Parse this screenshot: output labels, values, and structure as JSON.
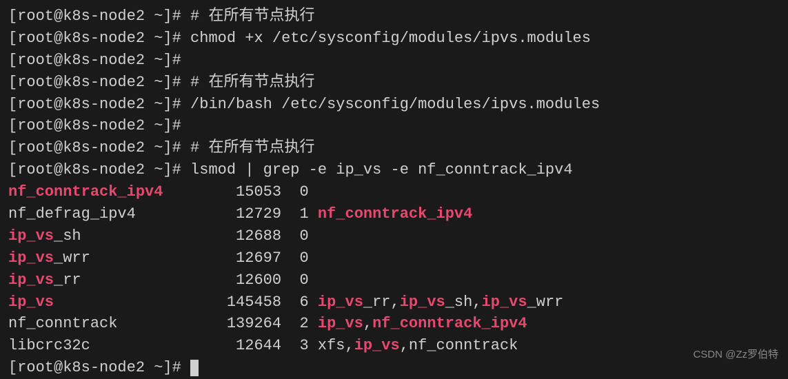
{
  "prompt": "[root@k8s-node2 ~]# ",
  "lines": [
    {
      "type": "cmd",
      "text": "# 在所有节点执行"
    },
    {
      "type": "cmd",
      "text": "chmod +x /etc/sysconfig/modules/ipvs.modules"
    },
    {
      "type": "cmd",
      "text": ""
    },
    {
      "type": "cmd",
      "text": "# 在所有节点执行"
    },
    {
      "type": "cmd",
      "text": "/bin/bash /etc/sysconfig/modules/ipvs.modules"
    },
    {
      "type": "cmd",
      "text": ""
    },
    {
      "type": "cmd",
      "text": "# 在所有节点执行"
    },
    {
      "type": "cmd",
      "text": "lsmod | grep -e ip_vs -e nf_conntrack_ipv4"
    }
  ],
  "lsmod": [
    {
      "col0_hl": "nf_conntrack_ipv4",
      "col0_rest": "",
      "size": "15053",
      "used": "0",
      "dep_plain1": "",
      "dep_hl1": "",
      "dep_plain2": "",
      "dep_hl2": "",
      "dep_plain3": "",
      "dep_hl3": "",
      "dep_plain4": ""
    },
    {
      "col0_hl": "",
      "col0_rest": "nf_defrag_ipv4",
      "size": "12729",
      "used": "1",
      "dep_plain1": " ",
      "dep_hl1": "nf_conntrack_ipv4",
      "dep_plain2": "",
      "dep_hl2": "",
      "dep_plain3": "",
      "dep_hl3": "",
      "dep_plain4": ""
    },
    {
      "col0_hl": "ip_vs",
      "col0_rest": "_sh",
      "size": "12688",
      "used": "0",
      "dep_plain1": "",
      "dep_hl1": "",
      "dep_plain2": "",
      "dep_hl2": "",
      "dep_plain3": "",
      "dep_hl3": "",
      "dep_plain4": ""
    },
    {
      "col0_hl": "ip_vs",
      "col0_rest": "_wrr",
      "size": "12697",
      "used": "0",
      "dep_plain1": "",
      "dep_hl1": "",
      "dep_plain2": "",
      "dep_hl2": "",
      "dep_plain3": "",
      "dep_hl3": "",
      "dep_plain4": ""
    },
    {
      "col0_hl": "ip_vs",
      "col0_rest": "_rr",
      "size": "12600",
      "used": "0",
      "dep_plain1": "",
      "dep_hl1": "",
      "dep_plain2": "",
      "dep_hl2": "",
      "dep_plain3": "",
      "dep_hl3": "",
      "dep_plain4": ""
    },
    {
      "col0_hl": "ip_vs",
      "col0_rest": "",
      "size": "145458",
      "used": "6",
      "dep_plain1": " ",
      "dep_hl1": "ip_vs",
      "dep_plain2": "_rr,",
      "dep_hl2": "ip_vs",
      "dep_plain3": "_sh,",
      "dep_hl3": "ip_vs",
      "dep_plain4": "_wrr"
    },
    {
      "col0_hl": "",
      "col0_rest": "nf_conntrack",
      "size": "139264",
      "used": "2",
      "dep_plain1": " ",
      "dep_hl1": "ip_vs",
      "dep_plain2": ",",
      "dep_hl2": "nf_conntrack_ipv4",
      "dep_plain3": "",
      "dep_hl3": "",
      "dep_plain4": ""
    },
    {
      "col0_hl": "",
      "col0_rest": "libcrc32c",
      "size": "12644",
      "used": "3",
      "dep_plain1": " xfs,",
      "dep_hl1": "ip_vs",
      "dep_plain2": ",nf_conntrack",
      "dep_hl2": "",
      "dep_plain3": "",
      "dep_hl3": "",
      "dep_plain4": ""
    }
  ],
  "cursor_prompt": "[root@k8s-node2 ~]# ",
  "watermark": "CSDN @Zz罗伯特"
}
